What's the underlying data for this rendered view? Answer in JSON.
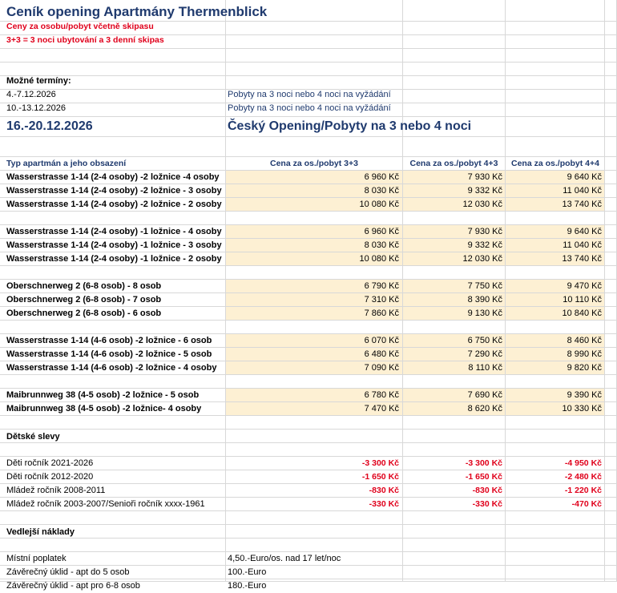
{
  "title": "Ceník opening  Apartmány Thermenblick",
  "subtitle1": "Ceny za osobu/pobyt včetně skipasu",
  "subtitle2": "3+3 = 3 noci ubytování a 3 denní skipas",
  "terms_label": "Možné termíny:",
  "terms": [
    {
      "date": "4.-7.12.2026",
      "note": "Pobyty na 3 noci nebo 4 noci na vyžádání"
    },
    {
      "date": "10.-13.12.2026",
      "note": "Pobyty na 3 noci nebo 4 noci na vyžádání"
    }
  ],
  "highlight_date": "16.-20.12.2026",
  "highlight_note": "Český Opening/Pobyty na 3 nebo 4 noci",
  "table_header": {
    "type": "Typ apartmán a jeho obsazení",
    "c1": "Cena  za os./pobyt 3+3",
    "c2": "Cena  za os./pobyt 4+3",
    "c3": "Cena  za os./pobyt 4+4"
  },
  "groups": [
    {
      "rows": [
        {
          "name": "Wasserstrasse 1-14 (2-4 osoby)  -2 ložnice  -4 osoby",
          "p1": "6 960 Kč",
          "p2": "7 930 Kč",
          "p3": "9 640 Kč"
        },
        {
          "name": "Wasserstrasse 1-14 (2-4 osoby)  -2 ložnice - 3 osoby",
          "p1": "8 030 Kč",
          "p2": "9 332 Kč",
          "p3": "11 040 Kč"
        },
        {
          "name": "Wasserstrasse 1-14 (2-4 osoby)  -2 ložnice - 2 osoby",
          "p1": "10 080 Kč",
          "p2": "12 030 Kč",
          "p3": "13 740 Kč"
        }
      ]
    },
    {
      "rows": [
        {
          "name": "Wasserstrasse 1-14 (2-4 osoby)  -1 ložnice - 4 osoby",
          "p1": "6 960 Kč",
          "p2": "7 930 Kč",
          "p3": "9 640 Kč"
        },
        {
          "name": "Wasserstrasse 1-14 (2-4 osoby)  -1 ložnice - 3 osoby",
          "p1": "8 030 Kč",
          "p2": "9 332 Kč",
          "p3": "11 040 Kč"
        },
        {
          "name": "Wasserstrasse 1-14 (2-4 osoby)  -1 ložnice - 2 osoby",
          "p1": "10 080 Kč",
          "p2": "12 030 Kč",
          "p3": "13 740 Kč"
        }
      ]
    },
    {
      "rows": [
        {
          "name": "Oberschnerweg 2 (6-8 osob) - 8 osob",
          "p1": "6 790 Kč",
          "p2": "7 750 Kč",
          "p3": "9 470 Kč"
        },
        {
          "name": "Oberschnerweg 2 (6-8 osob) - 7 osob",
          "p1": "7 310 Kč",
          "p2": "8 390 Kč",
          "p3": "10 110 Kč"
        },
        {
          "name": "Oberschnerweg 2 (6-8 osob) - 6 osob",
          "p1": "7 860 Kč",
          "p2": "9 130 Kč",
          "p3": "10 840 Kč"
        }
      ]
    },
    {
      "rows": [
        {
          "name": "Wasserstrasse 1-14 (4-6 osob)  -2 ložnice - 6 osob",
          "p1": "6 070 Kč",
          "p2": "6 750 Kč",
          "p3": "8 460 Kč"
        },
        {
          "name": "Wasserstrasse 1-14 (4-6 osob)  -2 ložnice - 5 osob",
          "p1": "6 480 Kč",
          "p2": "7 290 Kč",
          "p3": "8 990 Kč"
        },
        {
          "name": "Wasserstrasse 1-14 (4-6 osob)  -2 ložnice - 4 osoby",
          "p1": "7 090 Kč",
          "p2": "8 110 Kč",
          "p3": "9 820 Kč"
        }
      ]
    },
    {
      "rows": [
        {
          "name": "Maibrunnweg 38 (4-5 osob)  -2 ložnice - 5 osob",
          "p1": "6 780 Kč",
          "p2": "7 690 Kč",
          "p3": "9 390 Kč"
        },
        {
          "name": "Maibrunnweg 38 (4-5 osob)  -2 ložnice- 4 osoby",
          "p1": "7 470 Kč",
          "p2": "8 620 Kč",
          "p3": "10 330 Kč"
        }
      ]
    }
  ],
  "discounts_label": "Dětské slevy",
  "discounts": [
    {
      "name": "Děti ročník 2021-2026",
      "p1": "-3 300 Kč",
      "p2": "-3 300 Kč",
      "p3": "-4 950 Kč"
    },
    {
      "name": "Děti ročník 2012-2020",
      "p1": "-1 650 Kč",
      "p2": "-1 650 Kč",
      "p3": "-2 480 Kč"
    },
    {
      "name": "Mládež ročník 2008-2011",
      "p1": "-830 Kč",
      "p2": "-830 Kč",
      "p3": "-1 220 Kč"
    },
    {
      "name": "Mládež ročník 2003-2007/Senioři ročník xxxx-1961",
      "p1": "-330 Kč",
      "p2": "-330 Kč",
      "p3": "-470 Kč"
    }
  ],
  "costs_label": "Vedlejší náklady",
  "costs": [
    {
      "name": "Místní poplatek",
      "value": "4,50.-Euro/os. nad 17 let/noc"
    },
    {
      "name": "Závěrečný úklid - apt do 5 osob",
      "value": "100.-Euro"
    },
    {
      "name": "Závěrečný úklid - apt pro 6-8 osob",
      "value": "180.-Euro"
    }
  ],
  "colors": {
    "accent": "#1f3a6e",
    "red": "#e0001b",
    "row_fill": "#fdf0d3",
    "grid": "#d8d8d8"
  }
}
